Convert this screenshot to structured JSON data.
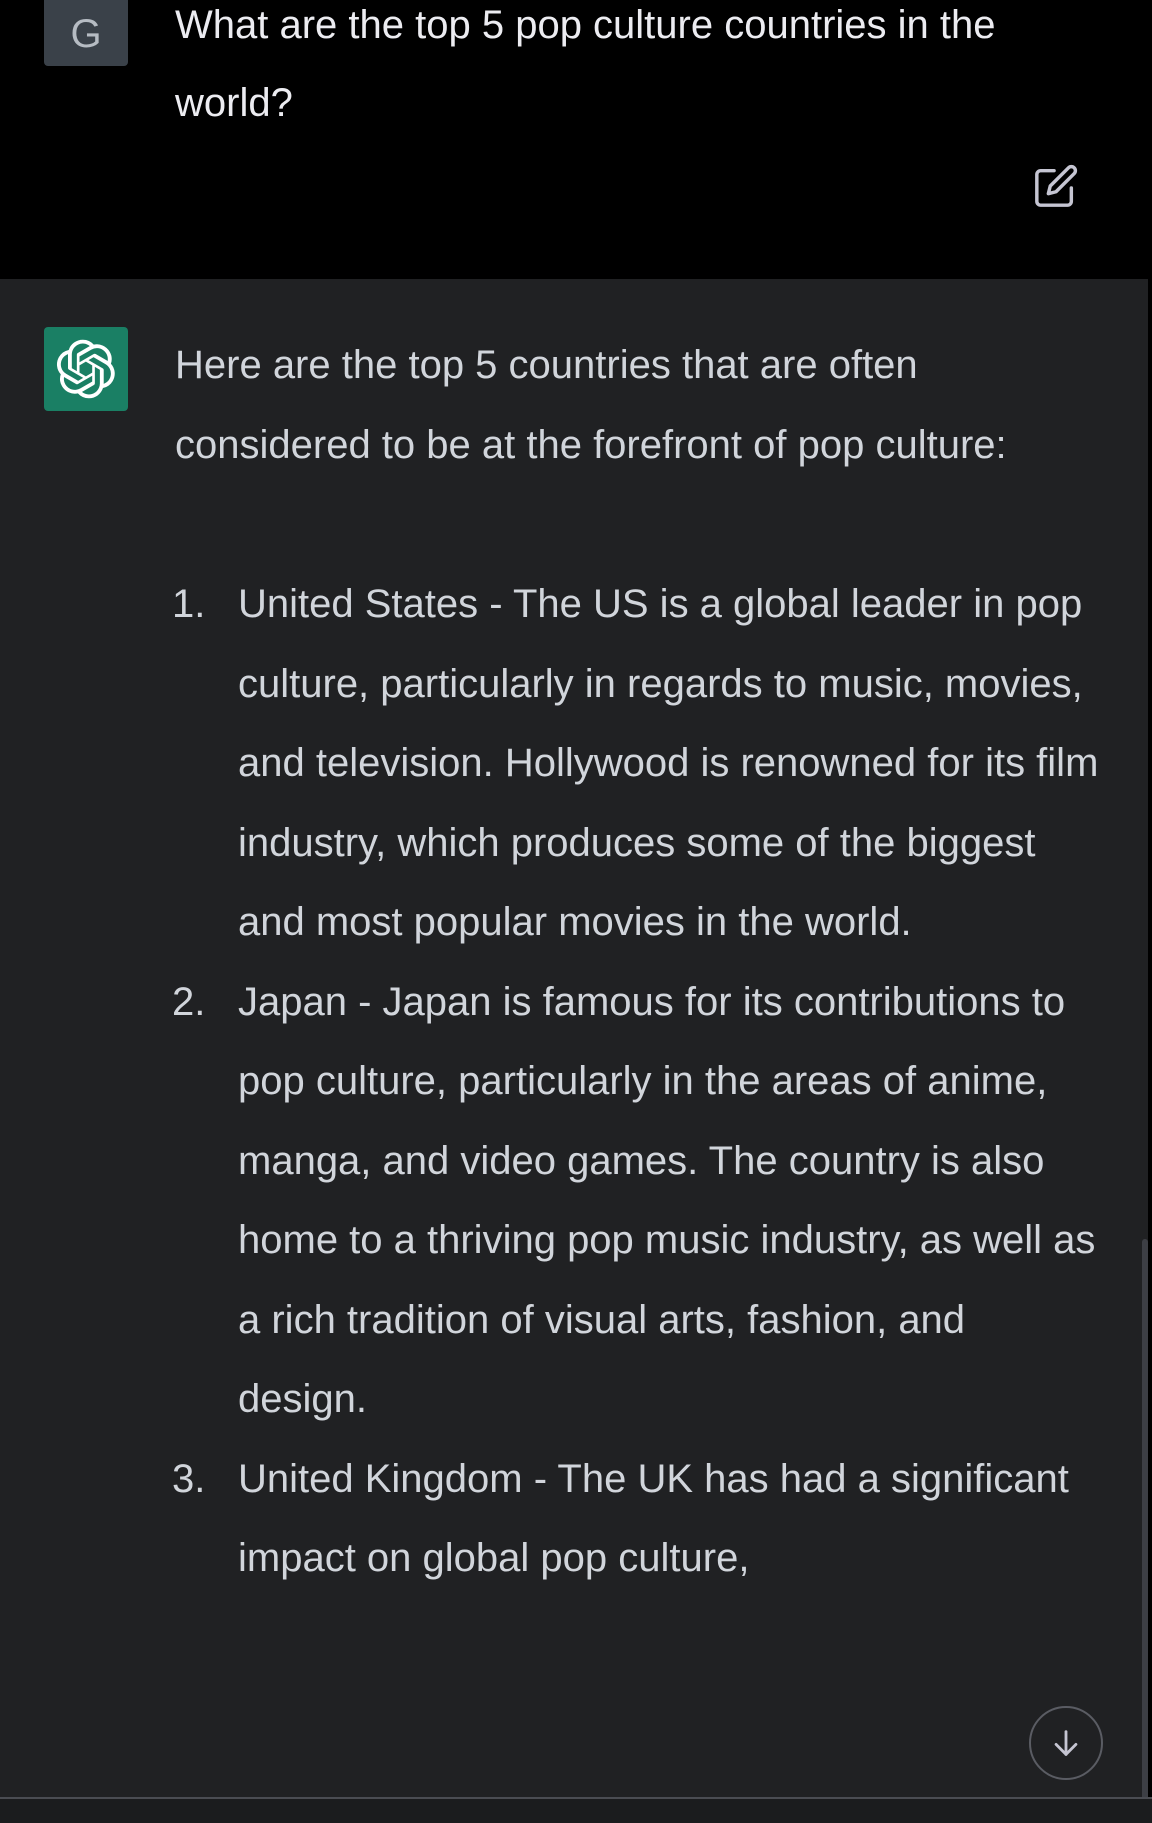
{
  "user": {
    "avatar_letter": "G",
    "message": "What are the top 5 pop culture countries in the world?"
  },
  "assistant": {
    "intro": "Here are the top 5 countries that are often considered to be at the forefront of pop culture:",
    "items": [
      {
        "number": "1.",
        "text": "United States - The US is a global leader in pop culture, particularly in regards to music, movies, and television. Hollywood is renowned for its film industry, which produces some of the biggest and most popular movies in the world."
      },
      {
        "number": "2.",
        "text": "Japan - Japan is famous for its contributions to pop culture, particularly in the areas of anime, manga, and video games. The country is also home to a thriving pop music industry, as well as a rich tradition of visual arts, fashion, and design."
      },
      {
        "number": "3.",
        "text": "United Kingdom - The UK has had a significant impact on global pop culture,"
      }
    ]
  },
  "icons": {
    "edit": "edit-icon",
    "assistant_logo": "openai-logo-icon",
    "scroll_down": "arrow-down-icon"
  },
  "colors": {
    "user_bg": "#000000",
    "assistant_bg": "#202123",
    "assistant_avatar": "#1a7f64",
    "user_avatar": "#3a4149"
  }
}
